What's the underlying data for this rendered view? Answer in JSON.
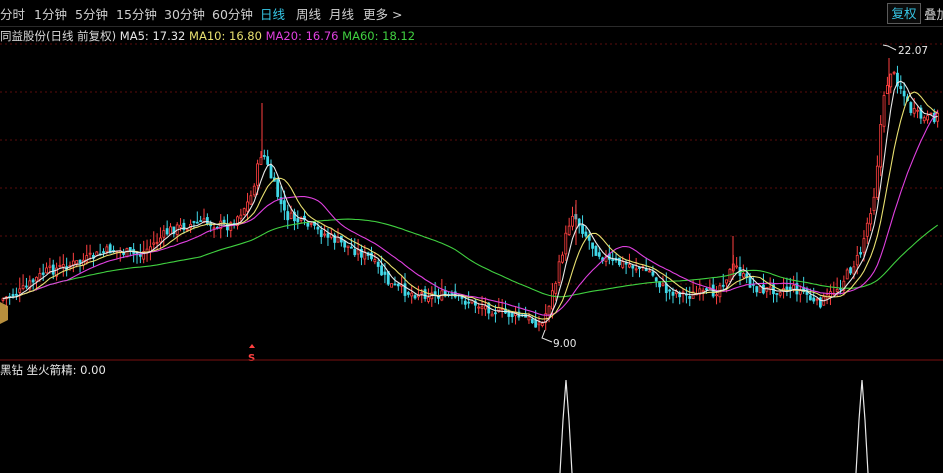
{
  "toolbar": {
    "periods": [
      "分时",
      "1分钟",
      "5分钟",
      "15分钟",
      "30分钟",
      "60分钟",
      "日线",
      "周线",
      "月线",
      "更多"
    ],
    "active_period": "日线",
    "more_arrow": ">",
    "fuquan_label": "复权",
    "diejia_label": "叠加"
  },
  "main_chart": {
    "stock_label": "同益股份(日线 前复权)",
    "ma": [
      {
        "name": "MA5",
        "value": "17.32",
        "color": "#e8e8e8"
      },
      {
        "name": "MA10",
        "value": "16.80",
        "color": "#e8e070"
      },
      {
        "name": "MA20",
        "value": "16.76",
        "color": "#e040e0"
      },
      {
        "name": "MA60",
        "value": "18.12",
        "color": "#40d040"
      }
    ],
    "high_label": "22.07",
    "low_label": "9.00",
    "signal_marker": "S",
    "up_color": "#ff4040",
    "down_color": "#40d8e8"
  },
  "indicator": {
    "label": "黑钻 坐火箭精: 0.00"
  }
}
